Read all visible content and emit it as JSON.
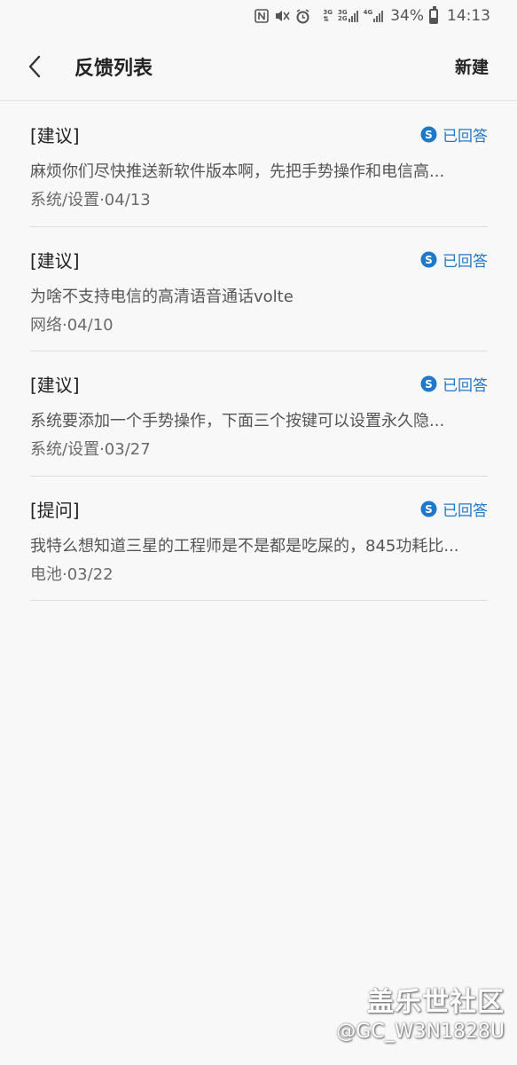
{
  "status_bar": {
    "battery_percent": "34%",
    "time": "14:13",
    "icons": [
      "nfc-icon",
      "mute-icon",
      "alarm-icon",
      "network-3g-icon",
      "signal-3g-2g-icon",
      "signal-4g-icon",
      "battery-icon"
    ],
    "net_labels": {
      "a_top": "3G",
      "a_bottom": "",
      "b_top": "3G",
      "b_bottom": "2G",
      "c_top": "4G",
      "c_bottom": ""
    }
  },
  "header": {
    "back_icon": "chevron-left-icon",
    "title": "反馈列表",
    "new_label": "新建"
  },
  "feedback_items": [
    {
      "type": "[建议]",
      "status": "已回答",
      "description": "麻烦你们尽快推送新软件版本啊，先把手势操作和电信高...",
      "meta": "系统/设置·04/13"
    },
    {
      "type": "[建议]",
      "status": "已回答",
      "description": "为啥不支持电信的高清语音通话volte",
      "meta": "网络·04/10"
    },
    {
      "type": "[建议]",
      "status": "已回答",
      "description": "系统要添加一个手势操作，下面三个按键可以设置永久隐...",
      "meta": "系统/设置·03/27"
    },
    {
      "type": "[提问]",
      "status": "已回答",
      "description": "我特么想知道三星的工程师是不是都是吃屎的，845功耗比...",
      "meta": "电池·03/22"
    }
  ],
  "colors": {
    "accent": "#1f78c8",
    "background": "#f8f8f9",
    "divider": "#dcdcde"
  },
  "watermark": {
    "brand": "盖乐世社区",
    "user": "@GC_W3N1828U"
  }
}
